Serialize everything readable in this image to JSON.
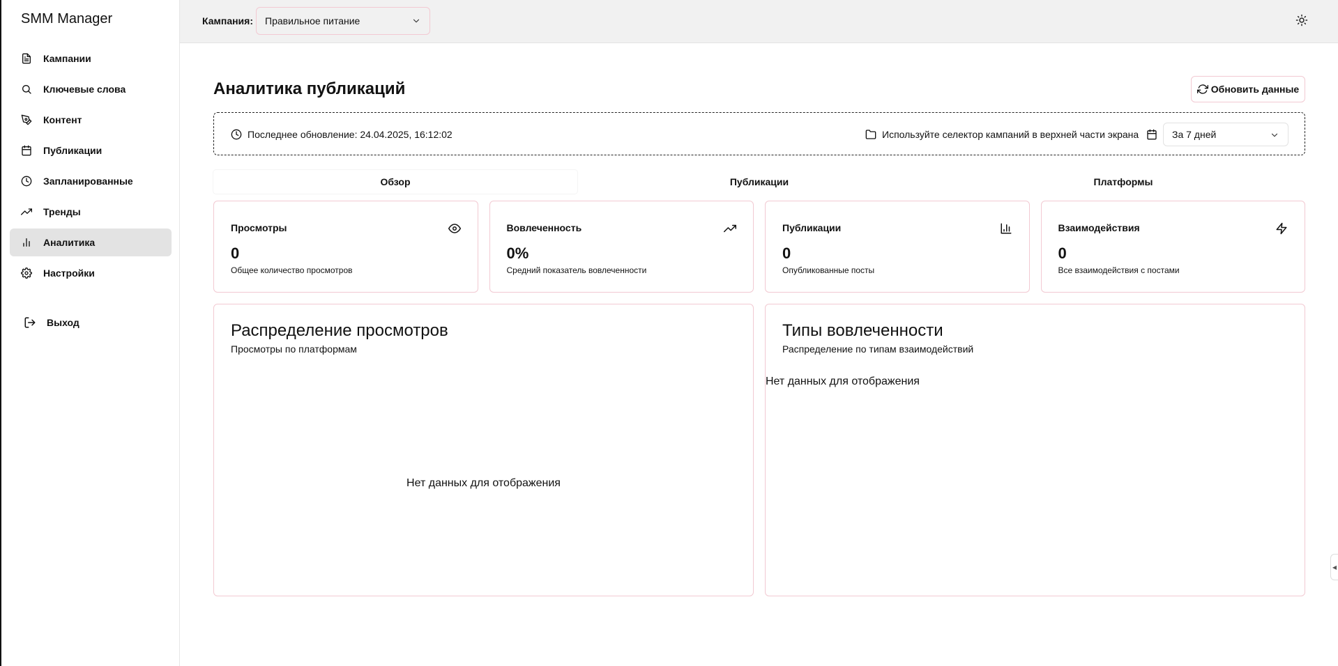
{
  "app": {
    "title": "SMM Manager"
  },
  "sidebar": {
    "items": [
      {
        "label": "Кампании",
        "icon": "file-icon"
      },
      {
        "label": "Ключевые слова",
        "icon": "search-icon"
      },
      {
        "label": "Контент",
        "icon": "pen-icon"
      },
      {
        "label": "Публикации",
        "icon": "calendar-icon"
      },
      {
        "label": "Запланированные",
        "icon": "clock-icon"
      },
      {
        "label": "Тренды",
        "icon": "trending-up-icon"
      },
      {
        "label": "Аналитика",
        "icon": "bar-chart-icon",
        "active": true
      },
      {
        "label": "Настройки",
        "icon": "gear-icon"
      }
    ],
    "logout_label": "Выход"
  },
  "topbar": {
    "campaign_label": "Кампания:",
    "campaign_value": "Правильное питание"
  },
  "main": {
    "title": "Аналитика публикаций",
    "refresh_label": "Обновить данные",
    "info": {
      "last_update": "Последнее обновление: 24.04.2025, 16:12:02",
      "hint": "Используйте селектор кампаний в верхней части экрана",
      "period": "За 7 дней"
    },
    "tabs": [
      {
        "label": "Обзор",
        "active": true
      },
      {
        "label": "Публикации"
      },
      {
        "label": "Платформы"
      }
    ],
    "cards": [
      {
        "title": "Просмотры",
        "value": "0",
        "sub": "Общее количество просмотров",
        "icon": "eye-icon"
      },
      {
        "title": "Вовлеченность",
        "value": "0%",
        "sub": "Средний показатель вовлеченности",
        "icon": "trending-up-icon"
      },
      {
        "title": "Публикации",
        "value": "0",
        "sub": "Опубликованные посты",
        "icon": "bar-chart-icon"
      },
      {
        "title": "Взаимодействия",
        "value": "0",
        "sub": "Все взаимодействия с постами",
        "icon": "zap-icon"
      }
    ],
    "panels": [
      {
        "title": "Распределение просмотров",
        "sub": "Просмотры по платформам",
        "empty": "Нет данных для отображения"
      },
      {
        "title": "Типы вовлеченности",
        "sub": "Распределение по типам взаимодействий",
        "empty": "Нет данных для отображения"
      }
    ]
  },
  "colors": {
    "accent_border": "#f2c9d2",
    "active_nav": "#e3e3e3",
    "topbar_bg": "#f1f1f1"
  }
}
